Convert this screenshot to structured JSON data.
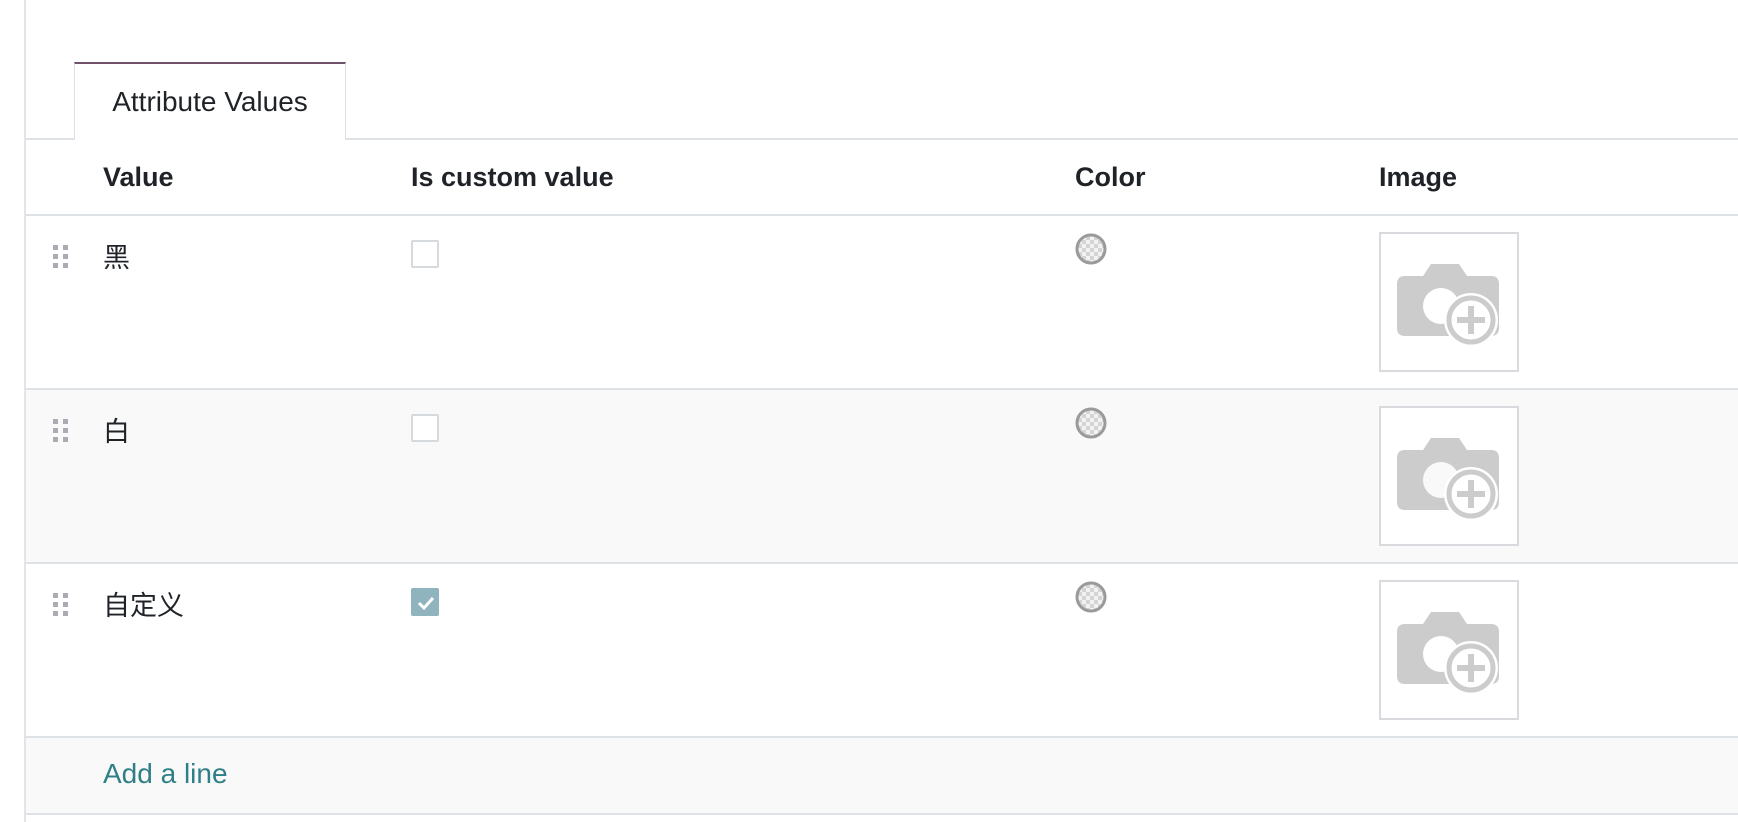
{
  "tabs": [
    {
      "label": "Attribute Values",
      "active": true
    }
  ],
  "table": {
    "columns": [
      "Value",
      "Is custom value",
      "Color",
      "Image"
    ],
    "rows": [
      {
        "value": "黑",
        "is_custom": false,
        "color": "none",
        "image": "empty"
      },
      {
        "value": "白",
        "is_custom": false,
        "color": "none",
        "image": "empty"
      },
      {
        "value": "自定义",
        "is_custom": true,
        "color": "none",
        "image": "empty"
      }
    ],
    "add_line_label": "Add a line"
  },
  "icons": {
    "drag": "drag-handle-icon",
    "color": "color-picker-swatch-icon",
    "image": "camera-add-icon",
    "check": "checkmark-icon"
  },
  "colors": {
    "tab_accent": "#71526b",
    "link": "#2f7f86",
    "checkbox_checked": "#8fb4bd",
    "placeholder_icon": "#cccccc"
  }
}
